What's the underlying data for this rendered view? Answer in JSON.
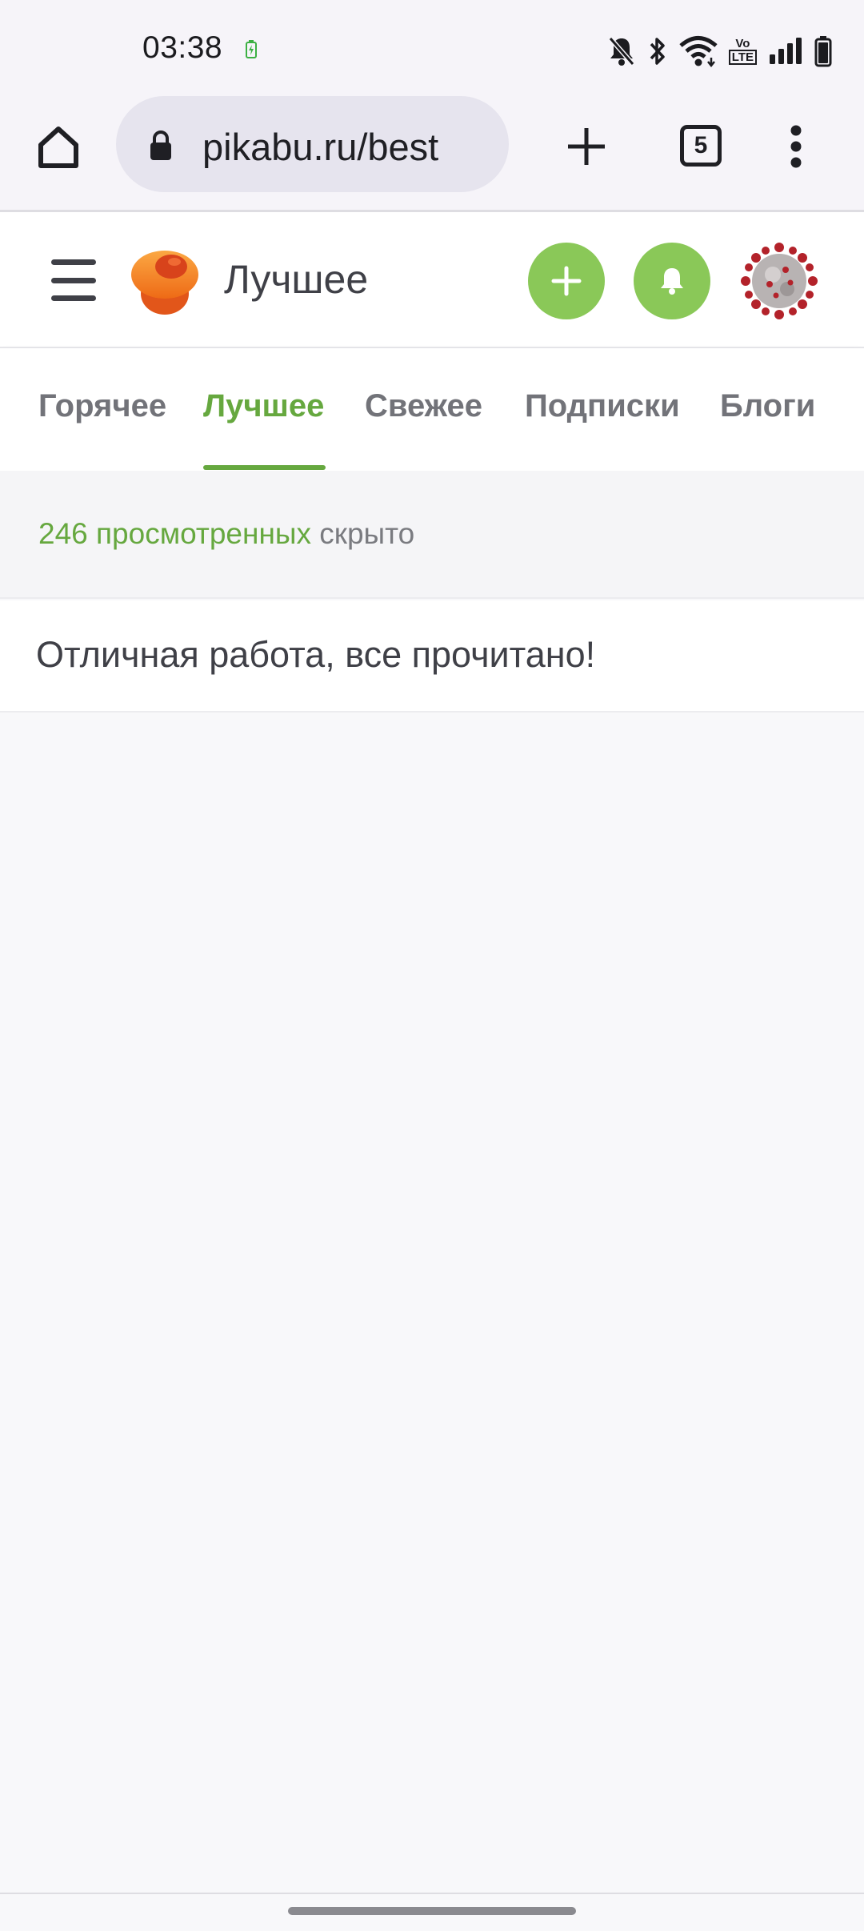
{
  "status_bar": {
    "time": "03:38",
    "icons": [
      "battery-charging-icon",
      "mute-icon",
      "bluetooth-icon",
      "wifi-icon",
      "volte-icon",
      "signal-icon",
      "battery-icon"
    ],
    "volte_text": {
      "top": "Vo",
      "bottom": "LTE"
    }
  },
  "browser": {
    "url": "pikabu.ru/best",
    "tabs_count": "5"
  },
  "header": {
    "title": "Лучшее",
    "colors": {
      "accent": "#8ac858",
      "logo_orange": "#f07a23"
    }
  },
  "tabs": [
    {
      "label": "Горячее",
      "active": false
    },
    {
      "label": "Лучшее",
      "active": true
    },
    {
      "label": "Свежее",
      "active": false
    },
    {
      "label": "Подписки",
      "active": false
    },
    {
      "label": "Блоги",
      "active": false
    }
  ],
  "content": {
    "viewed_count_link": "246 просмотренных",
    "hidden_label": "скрыто",
    "all_read_message": "Отличная работа, все прочитано!"
  }
}
